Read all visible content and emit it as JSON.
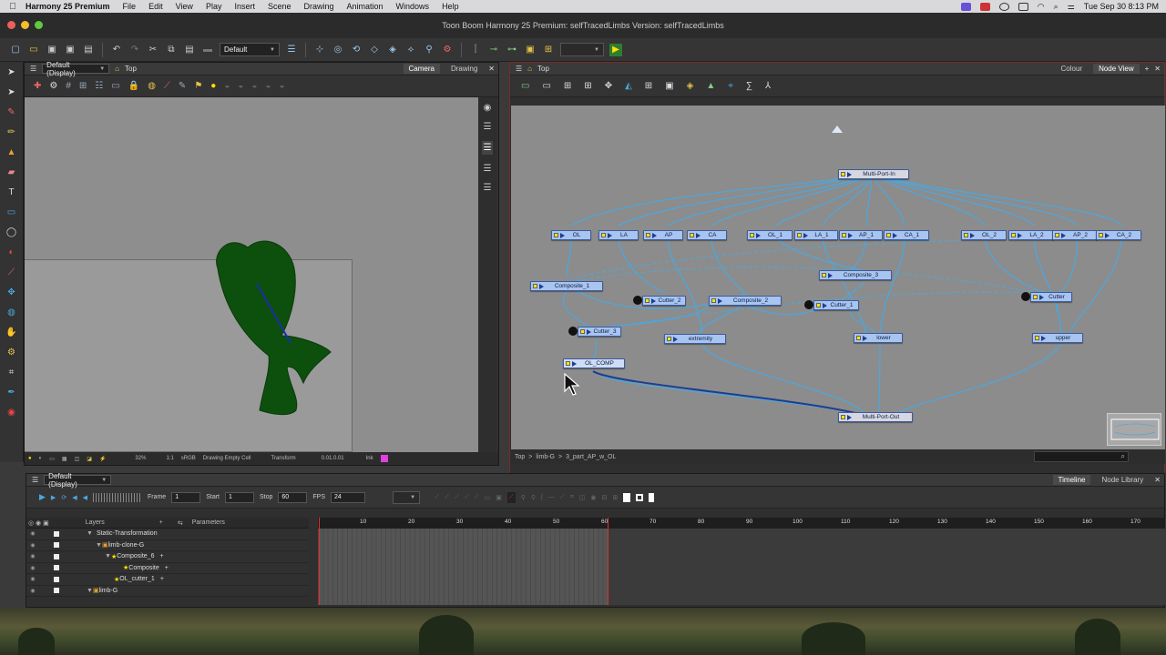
{
  "menubar": {
    "apple": "",
    "app_name": "Harmony 25 Premium",
    "items": [
      "File",
      "Edit",
      "View",
      "Play",
      "Insert",
      "Scene",
      "Drawing",
      "Animation",
      "Windows",
      "Help"
    ],
    "clock": "Tue Sep 30  8:13 PM"
  },
  "window": {
    "title": "Toon Boom Harmony 25 Premium: selfTracedLimbs Version: selfTracedLimbs"
  },
  "toolbar": {
    "workspace": "Default"
  },
  "camera_panel": {
    "view_combo": "Default (Display)",
    "breadcrumb": "Top",
    "tabs": [
      "Camera",
      "Drawing"
    ],
    "status": {
      "zoom": "32%",
      "ratio": "1:1",
      "color_space": "sRGB",
      "cell_info": "Drawing Empty Cell",
      "mode": "Transform",
      "coords": "0.01.0.01",
      "ink_label": "Ink"
    }
  },
  "node_panel": {
    "breadcrumb": "Top",
    "tabs": [
      "Colour",
      "Node View"
    ],
    "path": [
      "Top",
      ">",
      "limb-G",
      ">",
      "3_part_AP_w_OL"
    ],
    "nodes": [
      {
        "id": "multi-port-in",
        "label": "Multi-Port-In"
      },
      {
        "id": "ol",
        "label": "OL"
      },
      {
        "id": "la",
        "label": "LA"
      },
      {
        "id": "ap",
        "label": "AP"
      },
      {
        "id": "ca",
        "label": "CA"
      },
      {
        "id": "ol1",
        "label": "OL_1"
      },
      {
        "id": "la1",
        "label": "LA_1"
      },
      {
        "id": "ap1",
        "label": "AP_1"
      },
      {
        "id": "ca1",
        "label": "CA_1"
      },
      {
        "id": "ol2",
        "label": "OL_2"
      },
      {
        "id": "la2",
        "label": "LA_2"
      },
      {
        "id": "ap2",
        "label": "AP_2"
      },
      {
        "id": "ca2",
        "label": "CA_2"
      },
      {
        "id": "composite1",
        "label": "Composite_1"
      },
      {
        "id": "composite3",
        "label": "Composite_3"
      },
      {
        "id": "cutter2",
        "label": "Cutter_2"
      },
      {
        "id": "composite2",
        "label": "Composite_2"
      },
      {
        "id": "cutter1",
        "label": "Cutter_1"
      },
      {
        "id": "cutter",
        "label": "Cutter"
      },
      {
        "id": "cutter3",
        "label": "Cutter_3"
      },
      {
        "id": "extremity",
        "label": "extremity"
      },
      {
        "id": "lower",
        "label": "lower"
      },
      {
        "id": "upper",
        "label": "upper"
      },
      {
        "id": "ol-comp",
        "label": "OL_COMP"
      },
      {
        "id": "multi-port-out",
        "label": "Multi-Port-Out"
      }
    ]
  },
  "timeline": {
    "view_combo": "Default (Display)",
    "tabs": [
      "Timeline",
      "Node Library"
    ],
    "frame_label": "Frame",
    "frame_value": "1",
    "start_label": "Start",
    "start_value": "1",
    "stop_label": "Stop",
    "stop_value": "60",
    "fps_label": "FPS",
    "fps_value": "24",
    "layers_header": "Layers",
    "params_header": "Parameters",
    "ruler": [
      "10",
      "20",
      "30",
      "40",
      "50",
      "60",
      "70",
      "80",
      "90",
      "100",
      "110",
      "120",
      "130",
      "140",
      "150",
      "160",
      "170"
    ],
    "layers": [
      {
        "name": "Static-Transformation",
        "indent": 1
      },
      {
        "name": "limb-clone-G",
        "indent": 2
      },
      {
        "name": "Composite_6",
        "indent": 3
      },
      {
        "name": "Composite",
        "indent": 4
      },
      {
        "name": "OL_cutter_1",
        "indent": 3
      },
      {
        "name": "limb-G",
        "indent": 1
      }
    ]
  },
  "colors": {
    "node_fill": "#a8c4f0",
    "wire": "#4aa8e0",
    "drawing_fill": "#0d4f0d",
    "playhead": "#e03030"
  }
}
